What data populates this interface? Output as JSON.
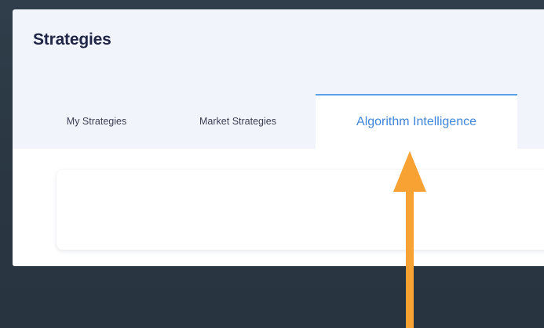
{
  "page": {
    "title": "Strategies"
  },
  "tabs": [
    {
      "label": "My Strategies",
      "active": false
    },
    {
      "label": "Market Strategies",
      "active": false
    },
    {
      "label": "Algorithm Intelligence",
      "active": true
    }
  ],
  "colors": {
    "background": "#2c3a46",
    "panel": "#f2f4fb",
    "title": "#1f2646",
    "active_tab_text": "#3d86dc",
    "active_tab_border": "#5aa0e6",
    "arrow": "#f7a233"
  },
  "annotation": {
    "icon": "up-arrow-icon",
    "target": "Algorithm Intelligence"
  }
}
